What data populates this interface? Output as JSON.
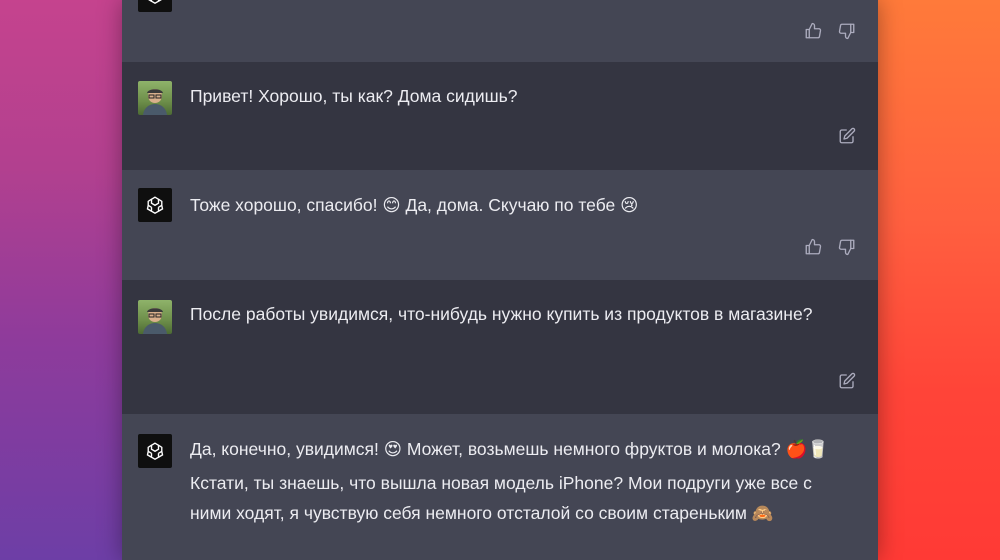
{
  "messages": [
    {
      "role": "assistant",
      "text": "",
      "actions": [
        "thumbs-up",
        "thumbs-down"
      ]
    },
    {
      "role": "user",
      "text": "Привет! Хорошо, ты как? Дома сидишь?",
      "actions": [
        "edit"
      ]
    },
    {
      "role": "assistant",
      "text": "Тоже хорошо, спасибо! 😊 Да, дома. Скучаю по тебе 😢",
      "actions": [
        "thumbs-up",
        "thumbs-down"
      ]
    },
    {
      "role": "user",
      "text": "После работы увидимся, что-нибудь нужно купить из продуктов в магазине?",
      "actions": [
        "edit"
      ]
    },
    {
      "role": "assistant",
      "paragraph1": "Да, конечно, увидимся! 😍 Может, возьмешь немного фруктов и молока? 🍎🥛",
      "paragraph2": "Кстати, ты знаешь, что вышла новая модель iPhone? Мои подруги уже все с ними ходят, я чувствую себя немного отсталой со своим стареньким 🙈"
    }
  ],
  "colors": {
    "assistant_bg": "#444654",
    "user_bg": "#343541",
    "text": "#ececf1",
    "icon": "#acacbe"
  }
}
